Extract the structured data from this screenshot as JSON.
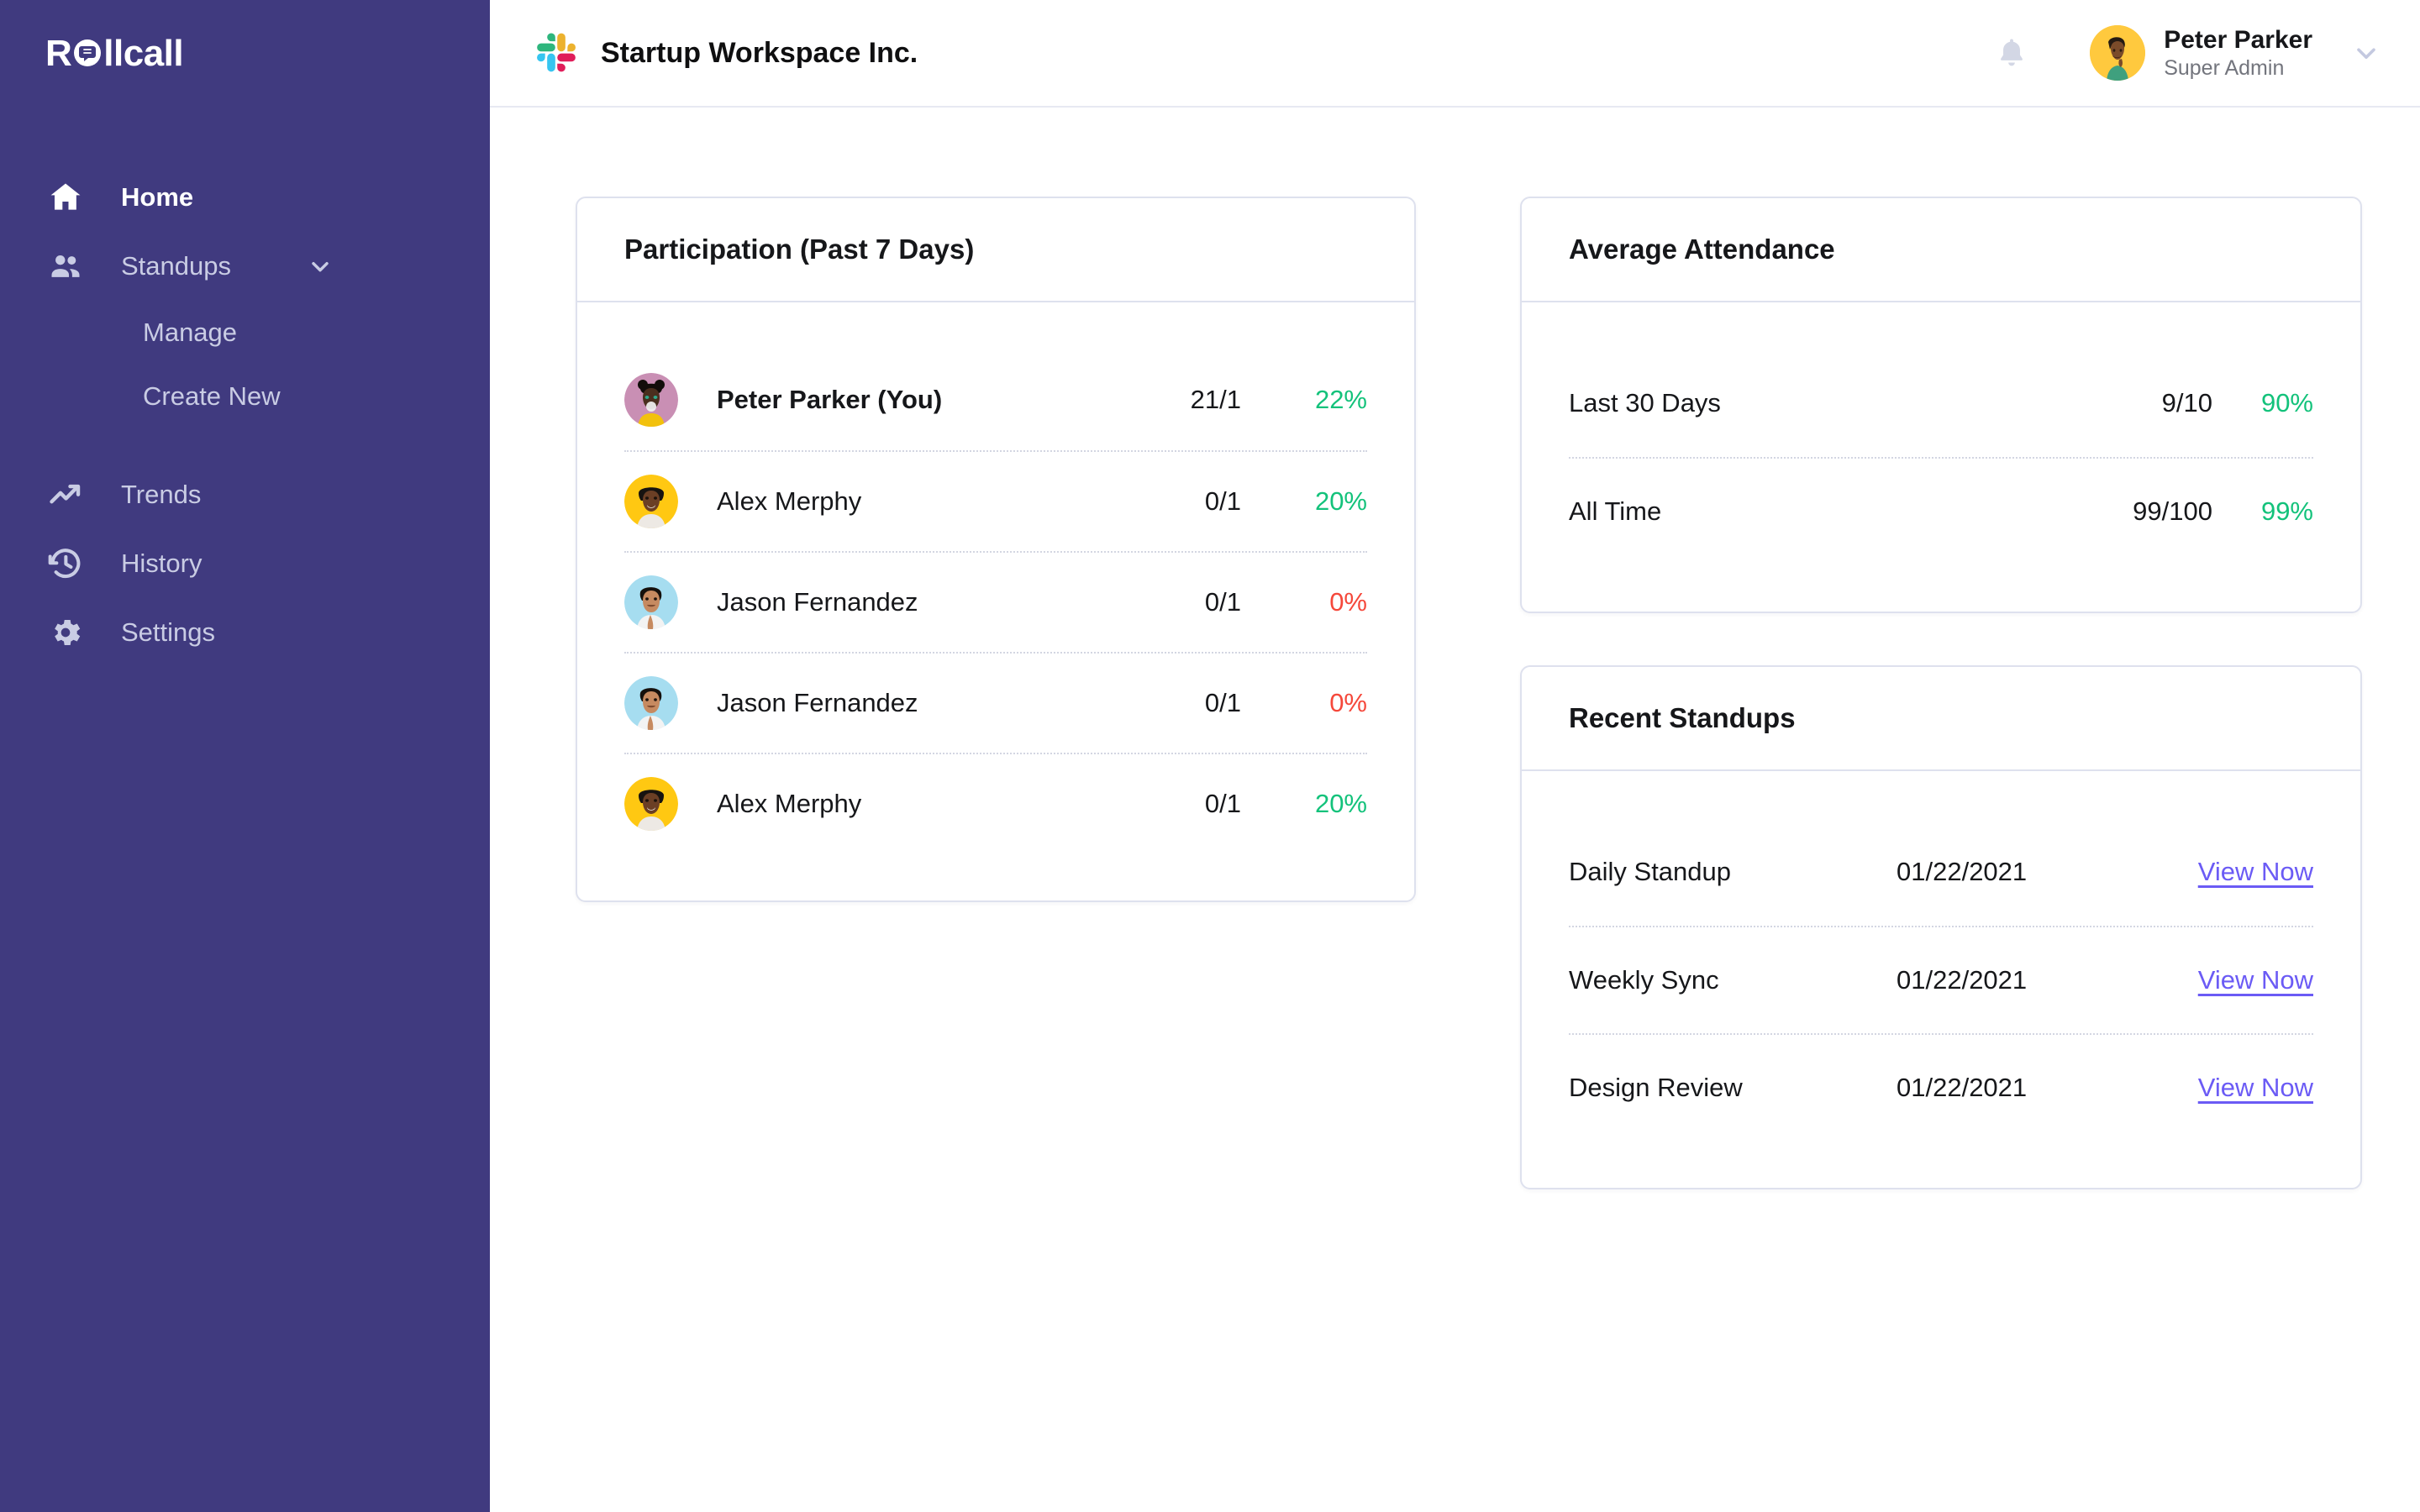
{
  "brand": {
    "name_before": "R",
    "name_after": "llcall",
    "full": "Rollcall"
  },
  "sidebar": {
    "items": [
      {
        "label": "Home",
        "icon": "home-icon",
        "active": true
      },
      {
        "label": "Standups",
        "icon": "people-icon",
        "active": false,
        "expanded": true
      },
      {
        "label": "Trends",
        "icon": "trending-up-icon",
        "active": false
      },
      {
        "label": "History",
        "icon": "history-icon",
        "active": false
      },
      {
        "label": "Settings",
        "icon": "gear-icon",
        "active": false
      }
    ],
    "standups_sub": [
      {
        "label": "Manage"
      },
      {
        "label": "Create New"
      }
    ]
  },
  "topbar": {
    "workspace_icon": "slack-logo-icon",
    "workspace_name": "Startup Workspace Inc.",
    "bell_icon": "notification-bell-icon",
    "user": {
      "name": "Peter Parker",
      "role": "Super Admin"
    },
    "user_chevron_icon": "chevron-down-icon"
  },
  "participation": {
    "title": "Participation (Past 7 Days)",
    "rows": [
      {
        "name": "Peter Parker (You)",
        "count": "21/1",
        "percent": "22%",
        "percent_state": "green",
        "is_me": true,
        "avatar": "avatar-peter"
      },
      {
        "name": "Alex Merphy",
        "count": "0/1",
        "percent": "20%",
        "percent_state": "green",
        "is_me": false,
        "avatar": "avatar-alex"
      },
      {
        "name": "Jason Fernandez",
        "count": "0/1",
        "percent": "0%",
        "percent_state": "red",
        "is_me": false,
        "avatar": "avatar-jason"
      },
      {
        "name": "Jason Fernandez",
        "count": "0/1",
        "percent": "0%",
        "percent_state": "red",
        "is_me": false,
        "avatar": "avatar-jason"
      },
      {
        "name": "Alex Merphy",
        "count": "0/1",
        "percent": "20%",
        "percent_state": "green",
        "is_me": false,
        "avatar": "avatar-alex"
      }
    ]
  },
  "attendance": {
    "title": "Average Attendance",
    "rows": [
      {
        "label": "Last 30 Days",
        "fraction": "9/10",
        "percent": "90%",
        "percent_state": "green"
      },
      {
        "label": "All Time",
        "fraction": "99/100",
        "percent": "99%",
        "percent_state": "green"
      }
    ]
  },
  "recent_standups": {
    "title": "Recent Standups",
    "rows": [
      {
        "name": "Daily Standup",
        "date": "01/22/2021",
        "action": "View Now"
      },
      {
        "name": "Weekly Sync",
        "date": "01/22/2021",
        "action": "View Now"
      },
      {
        "name": "Design Review",
        "date": "01/22/2021",
        "action": "View Now"
      }
    ]
  },
  "colors": {
    "sidebar": "#403A7F",
    "accent_link": "#6B5BF5",
    "positive": "#13C27B",
    "negative": "#F5483B",
    "border": "#DEE1EE"
  }
}
